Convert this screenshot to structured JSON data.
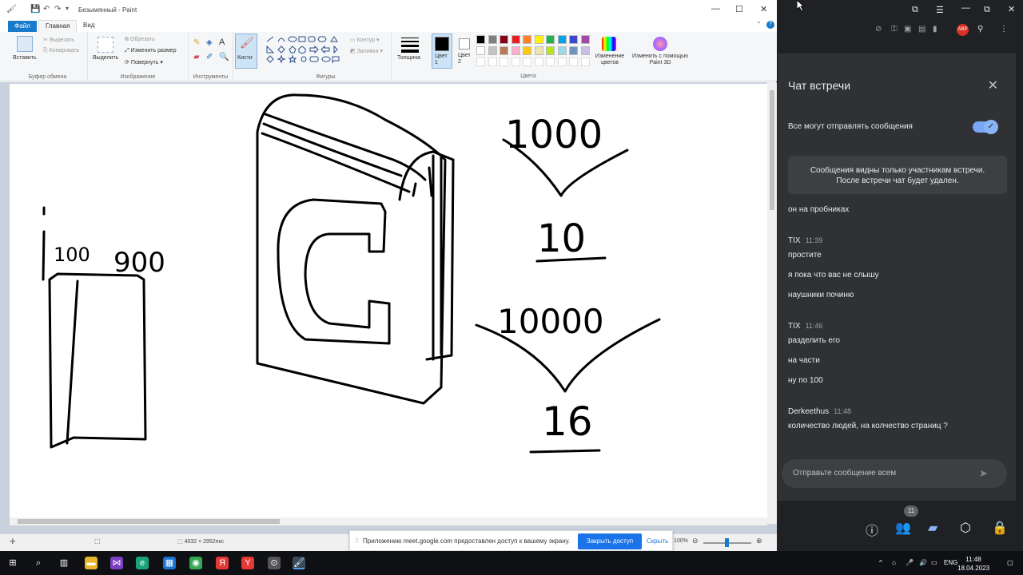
{
  "paint": {
    "title": "Безымянный - Paint",
    "tabs": {
      "file": "Файл",
      "home": "Главная",
      "view": "Вид"
    },
    "ribbon": {
      "paste": "Вставить",
      "cut": "Вырезать",
      "copy": "Копировать",
      "clipboard_group": "Буфер обмена",
      "select": "Выделить",
      "crop": "Обрезать",
      "resize": "Изменить размер",
      "rotate": "Повернуть",
      "image_group": "Изображение",
      "tools_group": "Инструменты",
      "brushes": "Кисти",
      "outline": "Контур",
      "fill": "Заливка",
      "shapes_group": "Фигуры",
      "size": "Толщина",
      "color1": "Цвет 1",
      "color2": "Цвет 2",
      "colors_group": "Цвета",
      "edit_colors": "Изменение цветов",
      "paint3d": "Изменить с помощью Paint 3D"
    },
    "palette_row1": [
      "#000000",
      "#7f7f7f",
      "#880015",
      "#ed1c24",
      "#ff7f27",
      "#fff200",
      "#22b14c",
      "#00a2e8",
      "#3f48cc",
      "#a349a4"
    ],
    "palette_row2": [
      "#ffffff",
      "#c3c3c3",
      "#b97a57",
      "#ffaec9",
      "#ffc90e",
      "#efe4b0",
      "#b5e61d",
      "#99d9ea",
      "#7092be",
      "#c8bfe7"
    ],
    "status": {
      "dims": "4032 × 2952пкс",
      "zoom": "100%"
    },
    "drawing_text": {
      "left_num1": "100",
      "left_num2": "900",
      "right_top": "1000",
      "right_mid": "10",
      "right_bot_top": "10000",
      "right_bot": "16"
    }
  },
  "share_bar": {
    "text": "Приложению meet.google.com предоставлен доступ к вашему экрану.",
    "stop": "Закрыть доступ",
    "hide": "Скрыть"
  },
  "chat": {
    "title": "Чат встречи",
    "toggle_label": "Все могут отправлять сообщения",
    "notice_line1": "Сообщения видны только участникам встречи.",
    "notice_line2": "После встречи чат будет удален.",
    "messages": [
      {
        "text": "он на пробниках"
      },
      {
        "sender": "TIX",
        "time": "11:39",
        "text": "простите"
      },
      {
        "text": "я пока что вас не слышу"
      },
      {
        "text": "наушники починю"
      },
      {
        "sender": "TIX",
        "time": "11:46",
        "text": "разделить его"
      },
      {
        "text": "на части"
      },
      {
        "text": "ну по 100"
      },
      {
        "sender": "Derkeethus",
        "time": "11:48",
        "text": "количество людей, на колчество страниц ?"
      }
    ],
    "input_placeholder": "Отправьте сообщение всем",
    "participants_count": "11"
  },
  "taskbar": {
    "lang": "ENG",
    "time": "11:48",
    "date": "18.04.2023"
  }
}
